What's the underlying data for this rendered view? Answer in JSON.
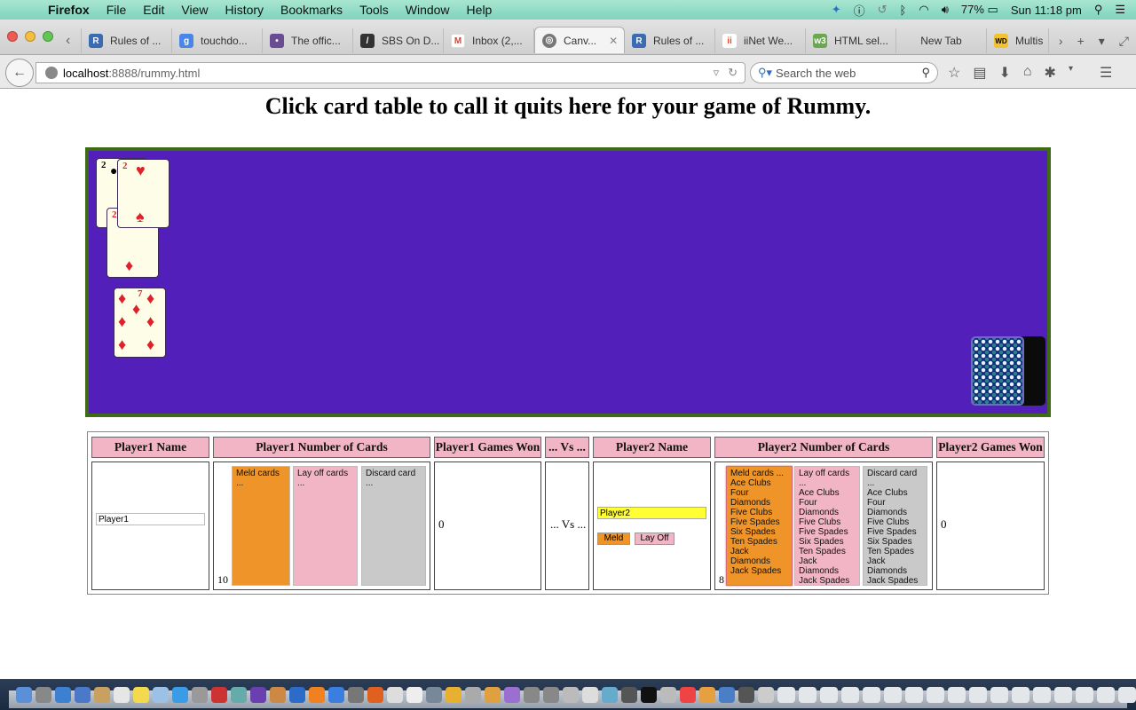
{
  "menubar": {
    "app": "Firefox",
    "menus": [
      "File",
      "Edit",
      "View",
      "History",
      "Bookmarks",
      "Tools",
      "Window",
      "Help"
    ],
    "battery": "77%",
    "clock": "Sun 11:18 pm"
  },
  "tabs": [
    {
      "label": "Rules of ...",
      "icon": "bookmark-favicon",
      "color": "#3b6bb3",
      "glyph": "R"
    },
    {
      "label": "touchdo...",
      "icon": "google-favicon",
      "color": "#4a86e8",
      "glyph": "g"
    },
    {
      "label": "The offic...",
      "icon": "afl-favicon",
      "color": "#6a4c93",
      "glyph": "•"
    },
    {
      "label": "SBS On D...",
      "icon": "sbs-favicon",
      "color": "#333333",
      "glyph": "/"
    },
    {
      "label": "Inbox (2,...",
      "icon": "gmail-favicon",
      "color": "#d14836",
      "glyph": "M"
    },
    {
      "label": "Canv...",
      "icon": "globe-favicon",
      "color": "#777777",
      "glyph": "◎",
      "active": true
    },
    {
      "label": "Rules of ...",
      "icon": "bookmark-favicon",
      "color": "#3b6bb3",
      "glyph": "R"
    },
    {
      "label": "iiNet We...",
      "icon": "iinet-favicon",
      "color": "#e0502a",
      "glyph": "ii"
    },
    {
      "label": "HTML sel...",
      "icon": "w3-favicon",
      "color": "#6aa84f",
      "glyph": "w3"
    },
    {
      "label": "New Tab",
      "icon": "",
      "color": "",
      "glyph": ""
    },
    {
      "label": "Multis",
      "icon": "wd-favicon",
      "color": "#f1c232",
      "glyph": "WD"
    }
  ],
  "navbar": {
    "url_host": "localhost",
    "url_path": ":8888/rummy.html",
    "search_placeholder": "Search the web"
  },
  "page": {
    "title": "Click card table to call it quits here for your game of Rummy.",
    "table_cards": [
      {
        "rank": "2",
        "suit": "clubs",
        "color": "black"
      },
      {
        "rank": "2",
        "suit": "hearts",
        "color": "red"
      },
      {
        "rank": "2",
        "suit": "diamonds",
        "color": "red"
      },
      {
        "rank": "7",
        "suit": "diamonds",
        "color": "red"
      }
    ],
    "suit_glyphs": {
      "hearts": "♥",
      "diamonds": "♦",
      "clubs": "♣",
      "spades": "♠"
    },
    "colors": {
      "felt": "#521fbb",
      "felt_border": "#3f6a17",
      "header_pink": "#f1b5c6",
      "meld_orange": "#ee9428",
      "discard_grey": "#c9c9c9",
      "name_yellow": "#ffff33"
    }
  },
  "scoreboard": {
    "headers": {
      "p1_name": "Player1 Name",
      "p1_cards": "Player1 Number of Cards",
      "p1_won": "Player1 Games Won",
      "vs": "... Vs ...",
      "p2_name": "Player2 Name",
      "p2_cards": "Player2 Number of Cards",
      "p2_won": "Player2 Games Won"
    },
    "player1": {
      "name": "Player1",
      "num_cards": "10",
      "games_won": "0",
      "meld_list": [
        "Meld cards ..."
      ],
      "layoff_list": [
        "Lay off cards ..."
      ],
      "discard_list": [
        "Discard card ..."
      ]
    },
    "vs_text": "... Vs ...",
    "player2": {
      "name": "Player2",
      "num_cards": "8",
      "games_won": "0",
      "meld_button": "Meld",
      "layoff_button": "Lay Off",
      "meld_list": [
        "Meld cards ...",
        "Ace Clubs",
        "Four Diamonds",
        "Five Clubs",
        "Five Spades",
        "Six Spades",
        "Ten Spades",
        "Jack Diamonds",
        "Jack Spades"
      ],
      "layoff_list": [
        "Lay off cards ...",
        "Ace Clubs",
        "Four Diamonds",
        "Five Clubs",
        "Five Spades",
        "Six Spades",
        "Ten Spades",
        "Jack Diamonds",
        "Jack Spades"
      ],
      "discard_list": [
        "Discard card ...",
        "Ace Clubs",
        "Four Diamonds",
        "Five Clubs",
        "Five Spades",
        "Six Spades",
        "Ten Spades",
        "Jack Diamonds",
        "Jack Spades"
      ]
    }
  }
}
